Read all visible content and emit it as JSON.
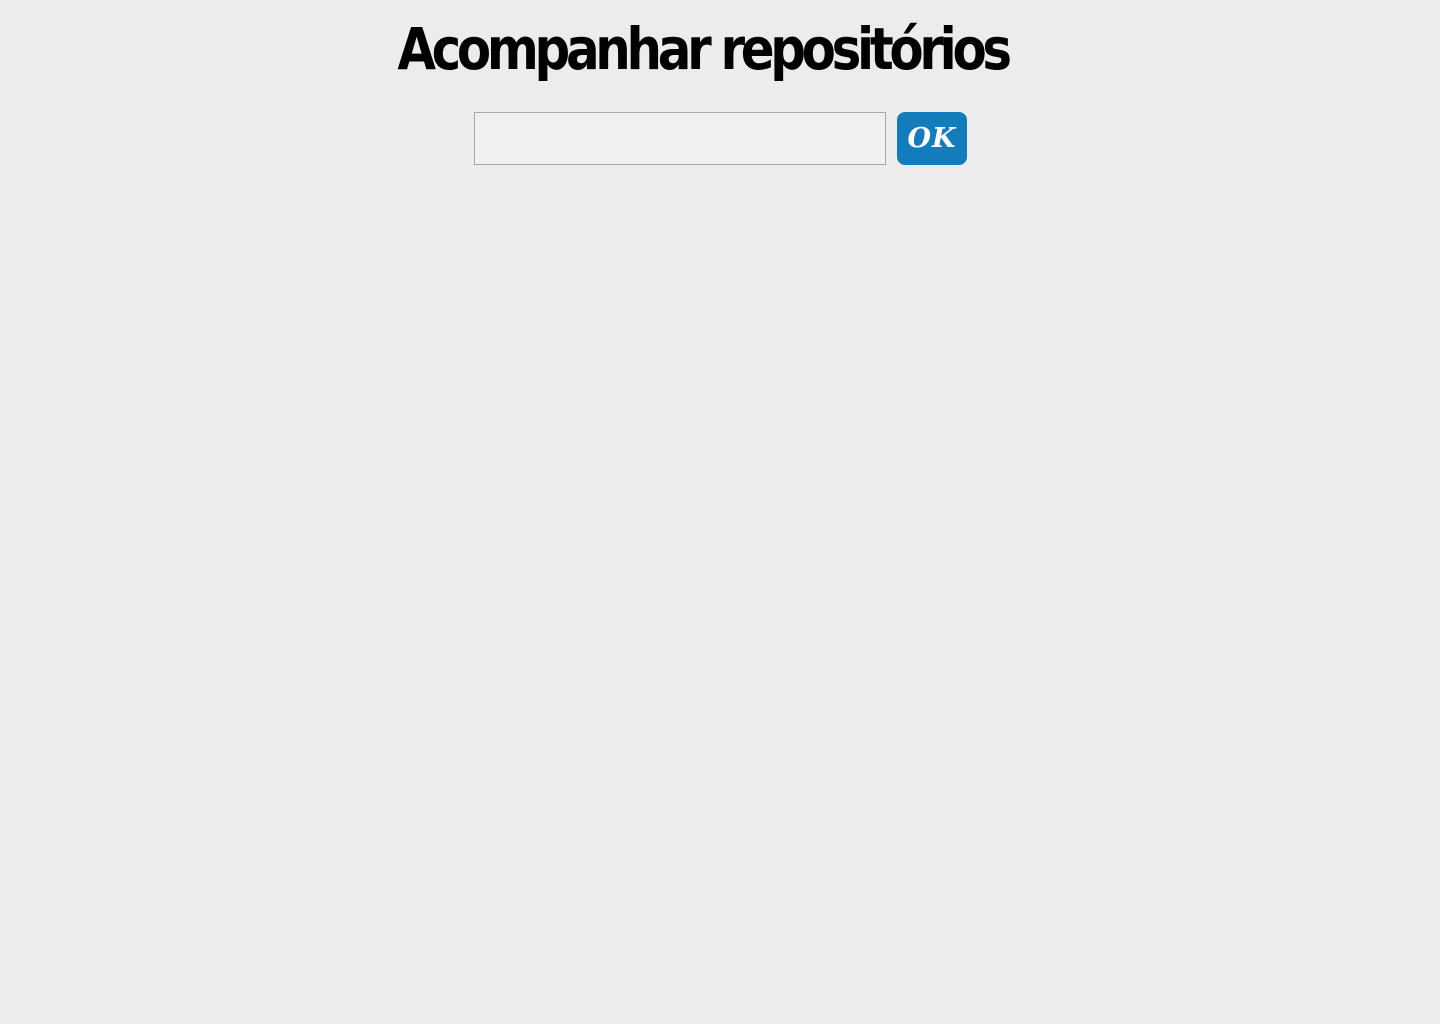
{
  "header": {
    "title": "Acompanhar repositórios"
  },
  "search": {
    "value": "",
    "placeholder": "",
    "submit_label": "OK"
  },
  "colors": {
    "background": "#ececec",
    "title": "#000000",
    "input_background": "#f0f0f0",
    "input_border": "#a8a8a8",
    "button_background": "#137cbd",
    "button_text": "#ffffff"
  }
}
